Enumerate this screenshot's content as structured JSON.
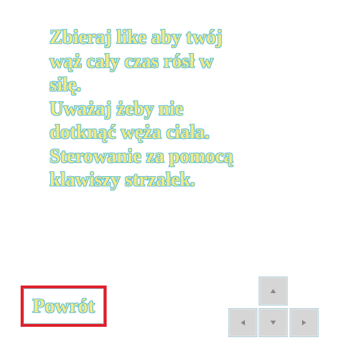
{
  "instructions": {
    "lines": [
      "Zbieraj like aby twój",
      "wąż cały czas rósł w",
      "siłę.",
      "Uważaj żeby nie",
      "dotknąć węża ciała.",
      "Sterowanie za pomocą",
      "klawiszy strzałek."
    ]
  },
  "back_button": {
    "label": "Powrót"
  },
  "arrow_keys": {
    "up": "arrow-up-icon",
    "left": "arrow-left-icon",
    "down": "arrow-down-icon",
    "right": "arrow-right-icon"
  },
  "colors": {
    "text_fill": "#f2ea82",
    "text_outline": "#5fc0dd",
    "button_border": "#e0202c",
    "key_fill": "#d6d6d6",
    "arrow": "#888888"
  }
}
